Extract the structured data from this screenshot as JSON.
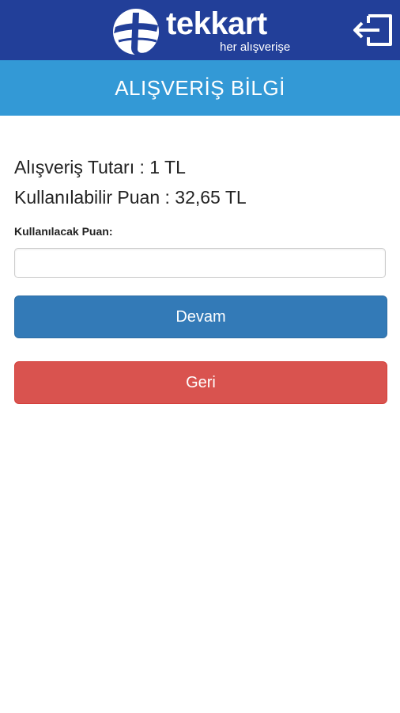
{
  "header": {
    "brand_name": "tekkart",
    "brand_tagline": "her alışverişe",
    "logout_icon": "logout-icon",
    "color": "#223f99"
  },
  "title_bar": {
    "title": "ALIŞVERİŞ BİLGİ",
    "color": "#3399d6"
  },
  "info": {
    "amount_line": "Alışveriş Tutarı : 1 TL",
    "points_line": "Kullanılabilir Puan : 32,65 TL"
  },
  "form": {
    "points_label": "Kullanılacak Puan:",
    "points_value": "",
    "points_placeholder": ""
  },
  "buttons": {
    "continue_label": "Devam",
    "continue_color": "#337ab7",
    "back_label": "Geri",
    "back_color": "#d9534f"
  }
}
